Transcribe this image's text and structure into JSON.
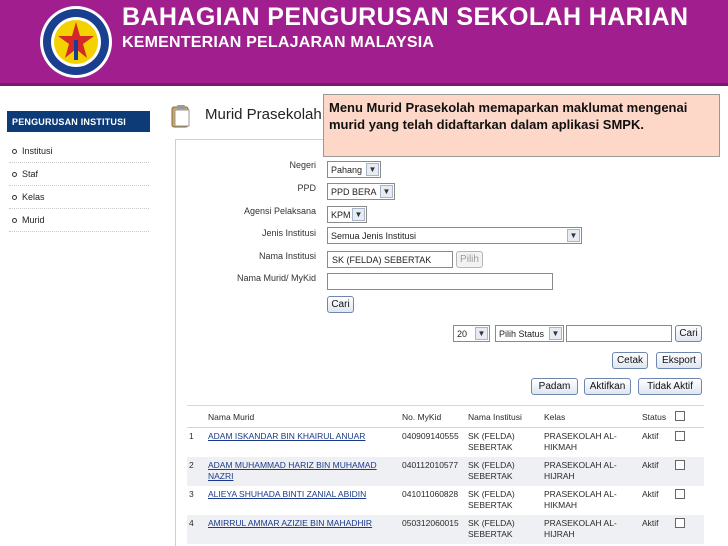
{
  "banner": {
    "title": "BAHAGIAN PENGURUSAN SEKOLAH HARIAN",
    "subtitle": "KEMENTERIAN PELAJARAN MALAYSIA",
    "logo_icon": "ministry-crest-icon"
  },
  "sidebar": {
    "header": "PENGURUSAN INSTITUSI",
    "items": [
      {
        "label": "Institusi"
      },
      {
        "label": "Staf"
      },
      {
        "label": "Kelas"
      },
      {
        "label": "Murid"
      }
    ]
  },
  "page": {
    "title": "Murid Prasekolah",
    "icon": "clipboard-icon"
  },
  "callout": {
    "text": "Menu Murid Prasekolah memaparkan maklumat mengenai murid yang telah didaftarkan  dalam aplikasi SMPK."
  },
  "form": {
    "negeri_label": "Negeri",
    "negeri_value": "Pahang",
    "ppd_label": "PPD",
    "ppd_value": "PPD BERA",
    "agensi_label": "Agensi Pelaksana",
    "agensi_value": "KPM",
    "jenis_label": "Jenis Institusi",
    "jenis_value": "Semua Jenis Institusi",
    "nama_label": "Nama Institusi",
    "nama_value": "SK (FELDA) SEBERTAK",
    "pilih_label": "Pilih",
    "murid_label": "Nama Murid/ MyKid",
    "murid_value": "",
    "cari_label": "Cari"
  },
  "toolbar": {
    "page_size": "20",
    "status_value": "Pilih Status",
    "search_value": "",
    "cari_label": "Cari",
    "cetak_label": "Cetak",
    "eksport_label": "Eksport",
    "padam_label": "Padam",
    "aktifkan_label": "Aktifkan",
    "tidak_aktif_label": "Tidak Aktif"
  },
  "table": {
    "headers": [
      "",
      "Nama Murid",
      "No. MyKid",
      "Nama Institusi",
      "Kelas",
      "Status",
      ""
    ],
    "rows": [
      {
        "no": "1",
        "name": "ADAM ISKANDAR BIN KHAIRUL ANUAR",
        "mykid": "040909140555",
        "institusi": "SK (FELDA) SEBERTAK",
        "kelas": "PRASEKOLAH AL-HIKMAH",
        "status": "Aktif"
      },
      {
        "no": "2",
        "name": "ADAM MUHAMMAD HARIZ BIN MUHAMAD NAZRI",
        "mykid": "040112010577",
        "institusi": "SK (FELDA) SEBERTAK",
        "kelas": "PRASEKOLAH AL-HIJRAH",
        "status": "Aktif"
      },
      {
        "no": "3",
        "name": "ALIEYA SHUHADA BINTI ZANIAL ABIDIN",
        "mykid": "041011060828",
        "institusi": "SK (FELDA) SEBERTAK",
        "kelas": "PRASEKOLAH AL-HIKMAH",
        "status": "Aktif"
      },
      {
        "no": "4",
        "name": "AMIRRUL AMMAR AZIZIE BIN MAHADHIR",
        "mykid": "050312060015",
        "institusi": "SK (FELDA) SEBERTAK",
        "kelas": "PRASEKOLAH AL-HIJRAH",
        "status": "Aktif"
      }
    ]
  }
}
